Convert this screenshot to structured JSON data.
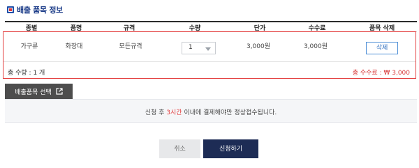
{
  "section": {
    "title": "배출 품목 정보"
  },
  "table": {
    "headers": [
      "종별",
      "품명",
      "규격",
      "수량",
      "단가",
      "수수료",
      "품목 삭제"
    ],
    "row": {
      "category": "가구류",
      "item": "화장대",
      "spec": "모든규격",
      "quantity": "1",
      "unit_price": "3,000원",
      "fee": "3,000원",
      "delete_label": "삭제"
    }
  },
  "summary": {
    "total_qty": "총 수량 : 1 개",
    "total_fee": "총 수수료 : ₩ 3,000"
  },
  "actions": {
    "select_items_label": "배출품목 선택",
    "cancel_label": "취소",
    "apply_label": "신청하기"
  },
  "notice": {
    "before": "신청 후 ",
    "highlight": "3시간",
    "after": " 이내에 결제해야만 정상접수됩니다."
  },
  "colors": {
    "accent_red": "#e23b3b",
    "navy": "#1d2c55",
    "title_blue": "#1f3f8a",
    "button_blue": "#4e8fd6"
  },
  "icons": [
    "title-square-icon",
    "external-link-icon",
    "dropdown-caret-icon"
  ]
}
